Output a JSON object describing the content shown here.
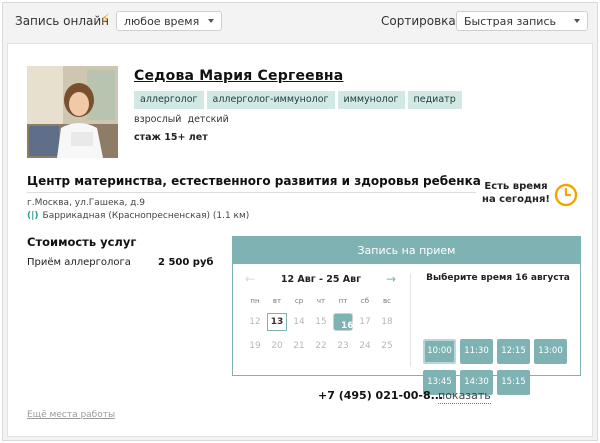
{
  "topbar": {
    "online_label": "Запись онлайн",
    "time_select": "любое время",
    "sort_label": "Сортировка:",
    "sort_select": "Быстрая запись"
  },
  "doctor": {
    "name": "Седова Мария Сергеевна",
    "tags": [
      "аллерголог",
      "аллерголог-иммунолог",
      "иммунолог",
      "педиатр"
    ],
    "age_groups": "взрослый  детский",
    "experience": "стаж 15+ лет"
  },
  "clinic": {
    "name": "Центр материнства, естественного развития и здоровья ребенка",
    "address": "г.Москва, ул.Гашека, д.9",
    "metro": "Баррикадная (Краснопресненская) (1.1 км)",
    "today_line1": "Есть время",
    "today_line2": "на сегодня!"
  },
  "services": {
    "title": "Стоимость услуг",
    "items": [
      {
        "name": "Приём аллерголога",
        "price": "2 500 руб"
      }
    ]
  },
  "booking": {
    "title": "Запись на прием",
    "range": "12 Авг - 25 Авг",
    "weekdays": [
      "пн",
      "вт",
      "ср",
      "чт",
      "пт",
      "сб",
      "вс"
    ],
    "weeks": [
      [
        "12",
        "13",
        "14",
        "15",
        "16",
        "17",
        "18"
      ],
      [
        "19",
        "20",
        "21",
        "22",
        "23",
        "24",
        "25"
      ]
    ],
    "today_day": "13",
    "selected_day": "16",
    "pick_title": "Выберите время 16 августа",
    "slots": [
      "10:00",
      "11:30",
      "12:15",
      "13:00",
      "13:45",
      "14:30",
      "15:15"
    ]
  },
  "contact": {
    "phone": "+7 (495) 021-00-8...",
    "show_link": "показать",
    "more_places": "Ещё места работы"
  },
  "colors": {
    "accent": "#7fb3b3",
    "tag_bg": "#d1e8e5",
    "clock": "#f0a500"
  }
}
